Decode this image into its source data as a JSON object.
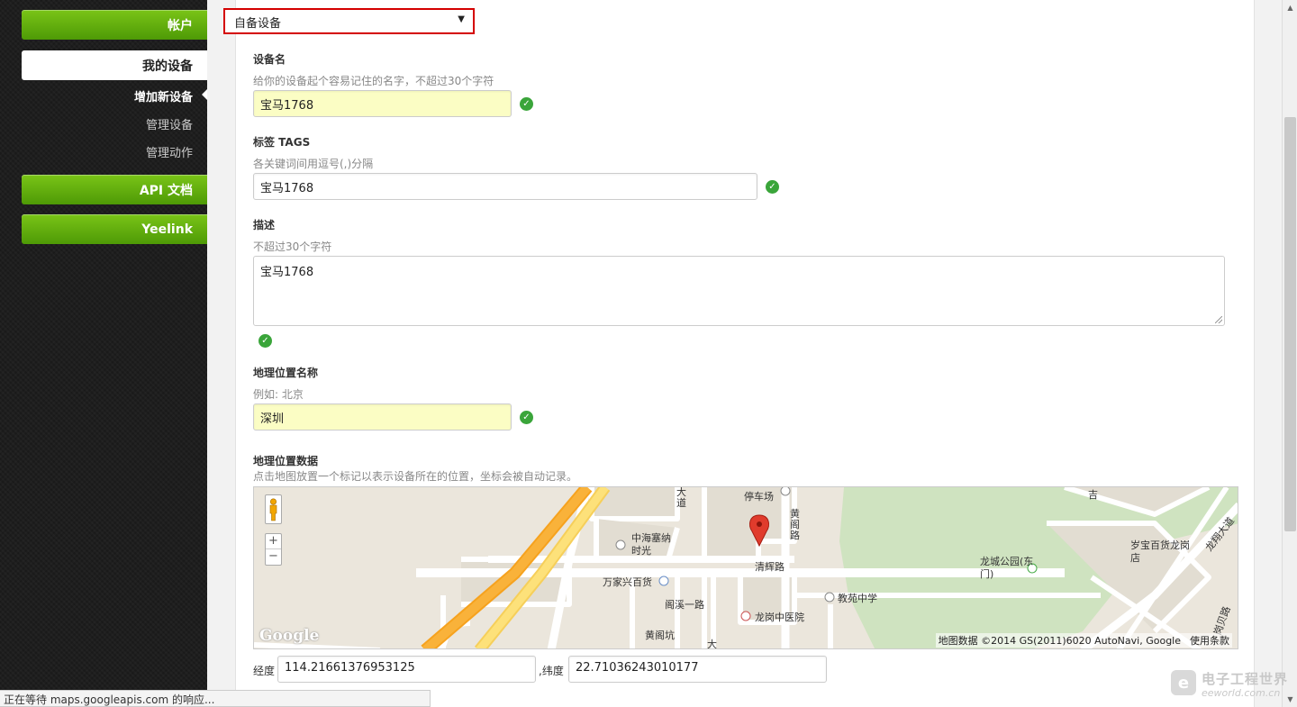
{
  "sidebar": {
    "account_label": "帐户",
    "my_devices_label": "我的设备",
    "sub_items": [
      "增加新设备",
      "管理设备",
      "管理动作"
    ],
    "api_docs_label": "API 文档",
    "yeelink_label": "Yeelink"
  },
  "form": {
    "device_type": {
      "value": "自备设备",
      "arrow": "▼"
    },
    "device_name": {
      "label": "设备名",
      "hint": "给你的设备起个容易记住的名字，不超过30个字符",
      "value": "宝马1768"
    },
    "tags": {
      "label": "标签 TAGS",
      "hint": "各关键词间用逗号(,)分隔",
      "value": "宝马1768"
    },
    "description": {
      "label": "描述",
      "hint": "不超过30个字符",
      "value": "宝马1768"
    },
    "location_name": {
      "label": "地理位置名称",
      "hint": "例如: 北京",
      "value": "深圳"
    },
    "location_data": {
      "label": "地理位置数据",
      "hint": "点击地图放置一个标记以表示设备所在的位置，坐标会被自动记录。"
    },
    "longitude": {
      "label": "经度",
      "value": "114.21661376953125"
    },
    "latitude": {
      "label": ",纬度",
      "value": "22.71036243010177"
    },
    "check_glyph": "✓"
  },
  "map": {
    "labels": [
      "停车场",
      "大道",
      "黄阁路",
      "中海塞纳时光",
      "清辉路",
      "万家兴百货",
      "阁溪一路",
      "龙岗中医院",
      "黄阁坑",
      "教苑中学",
      "龙城公园(东门)",
      "岁宝百货龙岗店",
      "龙翔大道",
      "吉",
      "岗贝路",
      "大"
    ],
    "google_logo": "Google",
    "attribution": "地图数据 ©2014 GS(2011)6020 AutoNavi, Google",
    "terms": "使用条款",
    "zoom_in": "+",
    "zoom_out": "−"
  },
  "status_bar": {
    "text": "正在等待 maps.googleapis.com 的响应..."
  },
  "watermark": {
    "line1": "电子工程世界",
    "line2": "eeworld.com.cn",
    "badge": "e"
  },
  "colors": {
    "accent_green": "#5ea80d",
    "highlight_red": "#d40000",
    "field_yellow": "#fbfdc4",
    "check_green": "#3aa53a"
  }
}
